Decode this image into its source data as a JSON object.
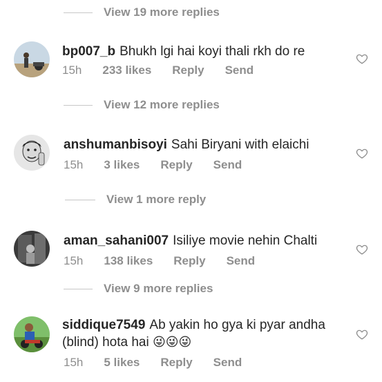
{
  "threads": [
    {
      "view_more": "View 19 more replies"
    },
    {
      "username": "bp007_b",
      "comment": "Bhukh lgi hai koyi thali rkh do re",
      "time": "15h",
      "likes": "233 likes",
      "reply": "Reply",
      "send": "Send",
      "view_more": "View 12 more replies"
    },
    {
      "username": "anshumanbisoyi",
      "comment": "Sahi Biryani with elaichi",
      "time": "15h",
      "likes": "3 likes",
      "reply": "Reply",
      "send": "Send",
      "view_more": "View 1 more reply"
    },
    {
      "username": "aman_sahani007",
      "comment": "Isiliye movie nehin Chalti",
      "time": "15h",
      "likes": "138 likes",
      "reply": "Reply",
      "send": "Send",
      "view_more": "View 9 more replies"
    },
    {
      "username": "siddique7549",
      "comment_line1": "Ab yakin ho gya ki pyar andha",
      "comment_line2": "(blind) hota hai",
      "emojis": "😜😜😜",
      "time": "15h",
      "likes": "5 likes",
      "reply": "Reply",
      "send": "Send"
    }
  ],
  "icons": {
    "like": "heart-outline-icon"
  },
  "colors": {
    "text": "#262626",
    "secondary": "#8e8e8e",
    "divider": "#c7c7c7"
  }
}
